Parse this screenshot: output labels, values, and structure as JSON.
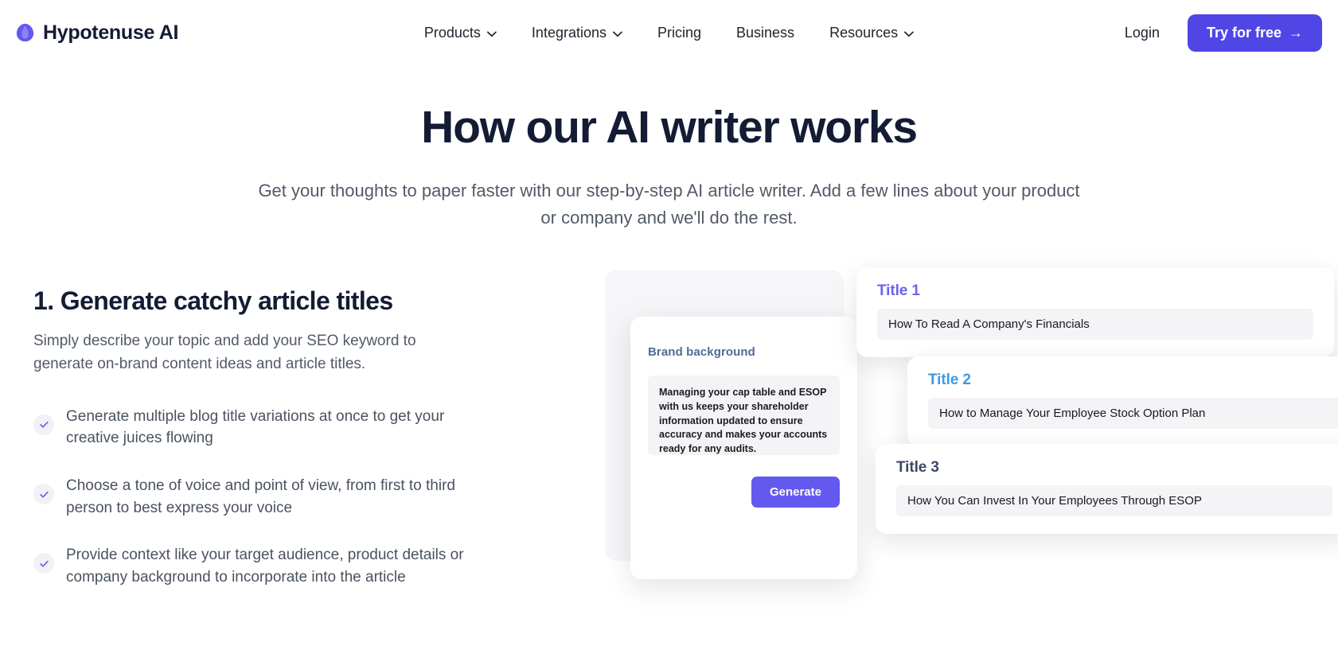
{
  "header": {
    "brand": {
      "name": "Hypotenuse AI",
      "logo_icon": "hypotenuse-logo-icon",
      "accent": "#6359ef"
    },
    "nav": [
      {
        "label": "Products",
        "has_dropdown": true
      },
      {
        "label": "Integrations",
        "has_dropdown": true
      },
      {
        "label": "Pricing",
        "has_dropdown": false
      },
      {
        "label": "Business",
        "has_dropdown": false
      },
      {
        "label": "Resources",
        "has_dropdown": true
      }
    ],
    "login_label": "Login",
    "cta_label": "Try for free",
    "cta_arrow": "→",
    "cta_color": "#5046e5"
  },
  "hero": {
    "title": "How our AI writer works",
    "subtitle": "Get your thoughts to paper faster with our step-by-step AI article writer. Add a few lines about your product or company and we'll do the rest."
  },
  "section": {
    "step_title": "1. Generate catchy article titles",
    "step_description": "Simply describe your topic and add your SEO keyword to generate on-brand content ideas and article titles.",
    "bullets": [
      {
        "text": "Generate multiple blog title variations at once to get your creative juices flowing"
      },
      {
        "text": "Choose a tone of voice and point of view, from first to third person to best express your voice"
      },
      {
        "text": "Provide context like your target audience, product details or company background to incorporate into the article"
      }
    ]
  },
  "illustration": {
    "brand_card": {
      "label": "Brand background",
      "label_color": "#4f6b96",
      "textarea_value": "Managing your cap table and ESOP with us keeps your shareholder information updated to ensure accuracy and makes your accounts ready for any audits.",
      "generate_label": "Generate",
      "generate_color": "#6359ef"
    },
    "title_cards": [
      {
        "label": "Title 1",
        "label_color": "#6b62ef",
        "value": "How To Read A Company's Financials"
      },
      {
        "label": "Title 2",
        "label_color": "#3b9be8",
        "value": "How to Manage Your Employee Stock Option Plan"
      },
      {
        "label": "Title 3",
        "label_color": "#3c4a63",
        "value": "How You Can Invest In Your Employees Through ESOP"
      }
    ]
  }
}
